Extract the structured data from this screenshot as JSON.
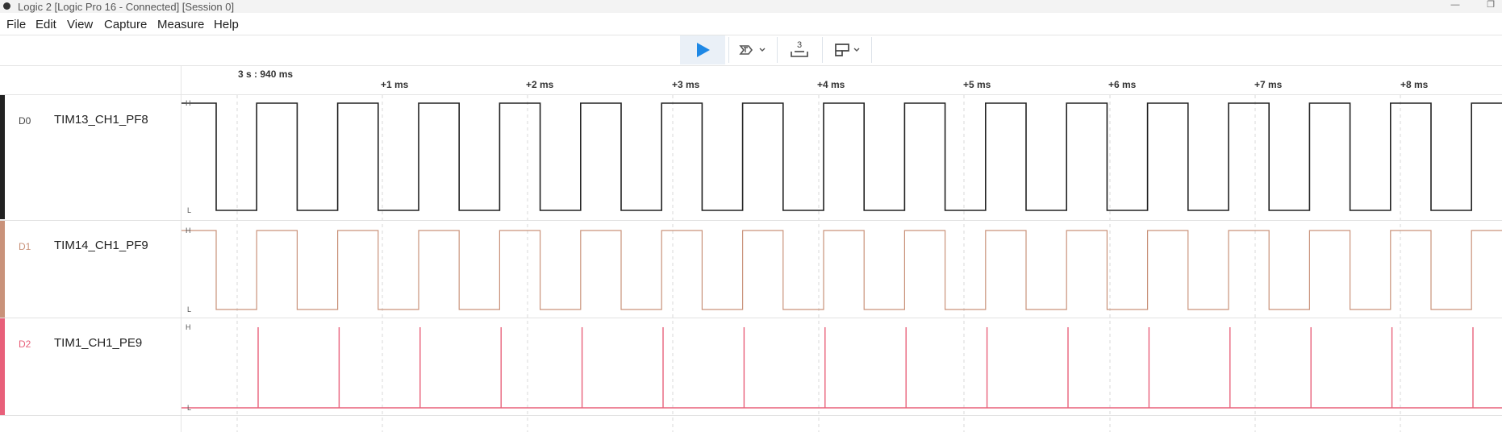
{
  "window": {
    "title": "Logic 2 [Logic Pro 16 - Connected] [Session 0]",
    "minimize_icon": "minimize-icon",
    "restore_icon": "restore-icon"
  },
  "menu": [
    "File",
    "Edit",
    "View",
    "Capture",
    "Measure",
    "Help"
  ],
  "toolbar": {
    "buttons": [
      {
        "name": "play",
        "icon": "play-icon",
        "color": "#1e88e5"
      },
      {
        "name": "trigger",
        "icon": "trigger-icon"
      },
      {
        "name": "channel-count",
        "icon": "channel-height-icon",
        "text": "3"
      },
      {
        "name": "view-options",
        "icon": "layout-icon"
      }
    ]
  },
  "timeline": {
    "origin": "3 s : 940 ms",
    "ticks": [
      "+1 ms",
      "+2 ms",
      "+3 ms",
      "+4 ms",
      "+5 ms",
      "+6 ms",
      "+7 ms",
      "+8 ms"
    ]
  },
  "level_labels": {
    "high": "H",
    "low": "L"
  },
  "channels": [
    {
      "id": "D0",
      "name": "TIM13_CH1_PF8",
      "color": "#222222"
    },
    {
      "id": "D1",
      "name": "TIM14_CH1_PF9",
      "color": "#c9927a"
    },
    {
      "id": "D2",
      "name": "TIM1_CH1_PE9",
      "color": "#e8607a"
    }
  ]
}
